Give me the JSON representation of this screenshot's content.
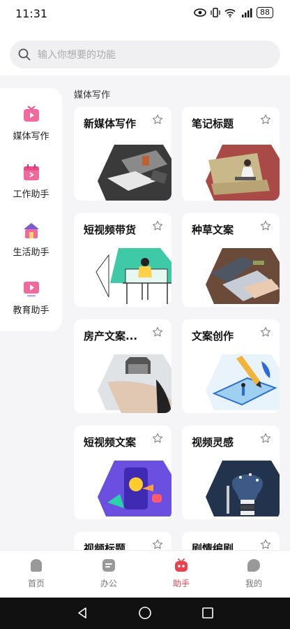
{
  "status": {
    "time": "11:31",
    "battery": "88"
  },
  "search": {
    "placeholder": "输入你想要的功能"
  },
  "sidebar": {
    "items": [
      {
        "label": "媒体写作",
        "icon": "tv-icon"
      },
      {
        "label": "工作助手",
        "icon": "calendar-icon"
      },
      {
        "label": "生活助手",
        "icon": "house-icon"
      },
      {
        "label": "教育助手",
        "icon": "play-icon"
      }
    ]
  },
  "section": {
    "title": "媒体写作"
  },
  "cards": [
    {
      "title": "新媒体写作",
      "image": "desk-photo"
    },
    {
      "title": "笔记标题",
      "image": "reading-illustration"
    },
    {
      "title": "短视频带货",
      "image": "desk-illustration"
    },
    {
      "title": "种草文案",
      "image": "laptop-photo"
    },
    {
      "title": "房产文案...",
      "image": "house-in-hand-photo"
    },
    {
      "title": "文案创作",
      "image": "pencil-illustration"
    },
    {
      "title": "短视频文案",
      "image": "phone-illustration"
    },
    {
      "title": "视频灵感",
      "image": "lightbulb-illustration"
    },
    {
      "title": "视频标题",
      "image": ""
    },
    {
      "title": "剧情编剧",
      "image": ""
    }
  ],
  "nav": {
    "tabs": [
      {
        "label": "首页"
      },
      {
        "label": "办公"
      },
      {
        "label": "助手"
      },
      {
        "label": "我的"
      }
    ],
    "active": "助手"
  },
  "colors": {
    "accent": "#e8424e",
    "category_icon": "#e84d8a"
  }
}
